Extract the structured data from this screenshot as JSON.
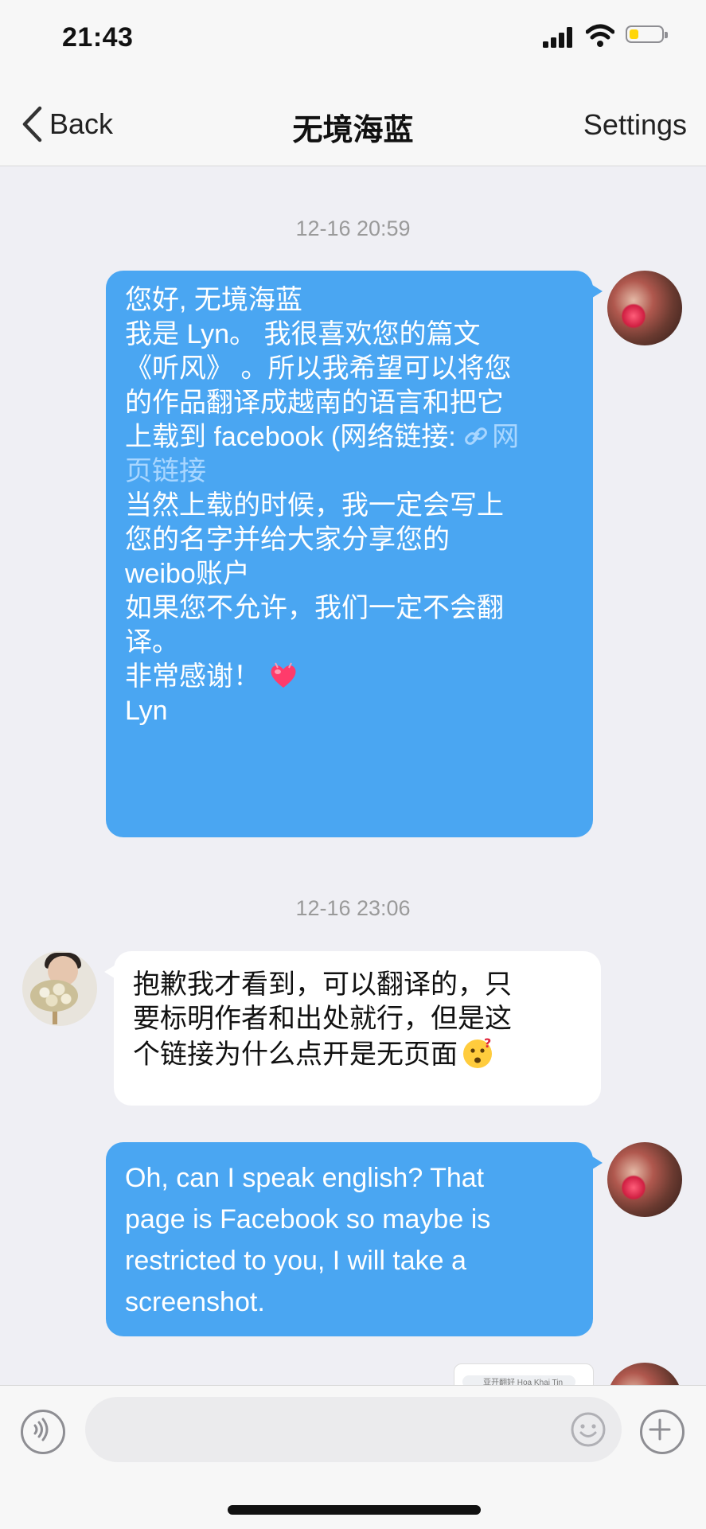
{
  "status_bar": {
    "time": "21:43"
  },
  "header": {
    "back_label": "Back",
    "title": "无境海蓝",
    "settings_label": "Settings"
  },
  "messages": [
    {
      "timestamp": "12-16 20:59"
    },
    {
      "sender": "me",
      "lines_before_link": "您好, 无境海蓝\n我是 Lyn。 我很喜欢您的篇文\n《听风》 。所以我希望可以将您\n的作品翻译成越南的语言和把它\n上载到 facebook (网络链接: ",
      "link_text": "网\n页链接",
      "lines_after_link": "\n当然上载的时候，我一定会写上\n您的名字并给大家分享您的\nweibo账户\n如果您不允许，我们一定不会翻\n译。\n非常感谢！",
      "signature": "\nLyn"
    },
    {
      "timestamp": "12-16 23:06"
    },
    {
      "sender": "them",
      "text": "抱歉我才看到，可以翻译的，只\n要标明作者和出处就行，但是这\n个链接为什么点开是无页面"
    },
    {
      "sender": "me",
      "text": "Oh, can I speak english? That\npage is Facebook so maybe is\nrestricted to you, I will take a\nscreenshot."
    }
  ],
  "image_preview": {
    "caption": "亚开翻好 Hoa Khai Tin"
  },
  "input": {
    "placeholder": ""
  },
  "colors": {
    "my_bubble": "#4aa6f2",
    "their_bubble": "#ffffff",
    "background": "#efeff4",
    "link": "#a8d6ff"
  }
}
